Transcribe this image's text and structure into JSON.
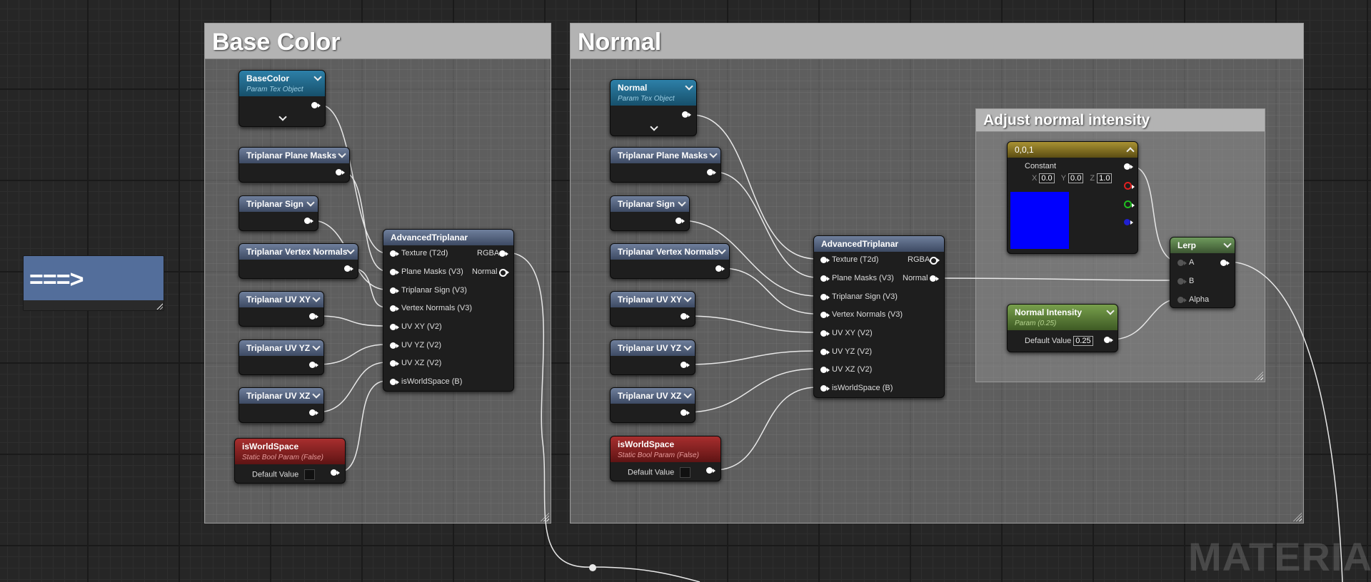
{
  "reroute_node": {
    "label": "===>"
  },
  "comments": {
    "base_color": "Base Color",
    "normal": "Normal",
    "adjust": "Adjust normal intensity"
  },
  "base": {
    "tex_object": {
      "title": "BaseColor",
      "subtitle": "Param Tex Object"
    },
    "plane_masks": "Triplanar Plane Masks",
    "sign": "Triplanar Sign",
    "vertex_normals": "Triplanar Vertex Normals",
    "uv_xy": "Triplanar UV XY",
    "uv_yz": "Triplanar UV YZ",
    "uv_xz": "Triplanar UV XZ",
    "world_space": {
      "title": "isWorldSpace",
      "subtitle": "Static Bool Param (False)",
      "default_label": "Default Value"
    }
  },
  "normal": {
    "tex_object": {
      "title": "Normal",
      "subtitle": "Param Tex Object"
    },
    "plane_masks": "Triplanar Plane Masks",
    "sign": "Triplanar Sign",
    "vertex_normals": "Triplanar Vertex Normals",
    "uv_xy": "Triplanar UV XY",
    "uv_yz": "Triplanar UV YZ",
    "uv_xz": "Triplanar UV XZ",
    "world_space": {
      "title": "isWorldSpace",
      "subtitle": "Static Bool Param (False)",
      "default_label": "Default Value"
    }
  },
  "advanced_triplanar": {
    "title": "AdvancedTriplanar",
    "inputs": [
      "Texture (T2d)",
      "Plane Masks (V3)",
      "Triplanar Sign (V3)",
      "Vertex Normals (V3)",
      "UV XY (V2)",
      "UV YZ (V2)",
      "UV XZ (V2)",
      "isWorldSpace (B)"
    ],
    "outputs": [
      "RGBA",
      "Normal"
    ]
  },
  "constant3": {
    "title": "0,0,1",
    "label": "Constant",
    "x_label": "X",
    "x": "0.0",
    "y_label": "Y",
    "y": "0.0",
    "z_label": "Z",
    "z": "1.0",
    "swatch_color": "#0000ff"
  },
  "lerp": {
    "title": "Lerp",
    "inputs": [
      "A",
      "B",
      "Alpha"
    ]
  },
  "normal_intensity": {
    "title": "Normal Intensity",
    "subtitle": "Param (0.25)",
    "default_label": "Default Value",
    "value": "0.25"
  },
  "watermark": "MATERIAL",
  "colors": {
    "param_blue": "#2d80a8",
    "bool_red": "#a82e2e",
    "scalar_green": "#78a04c",
    "vector_gold": "#a99233",
    "function_blue": "#536e9b"
  }
}
